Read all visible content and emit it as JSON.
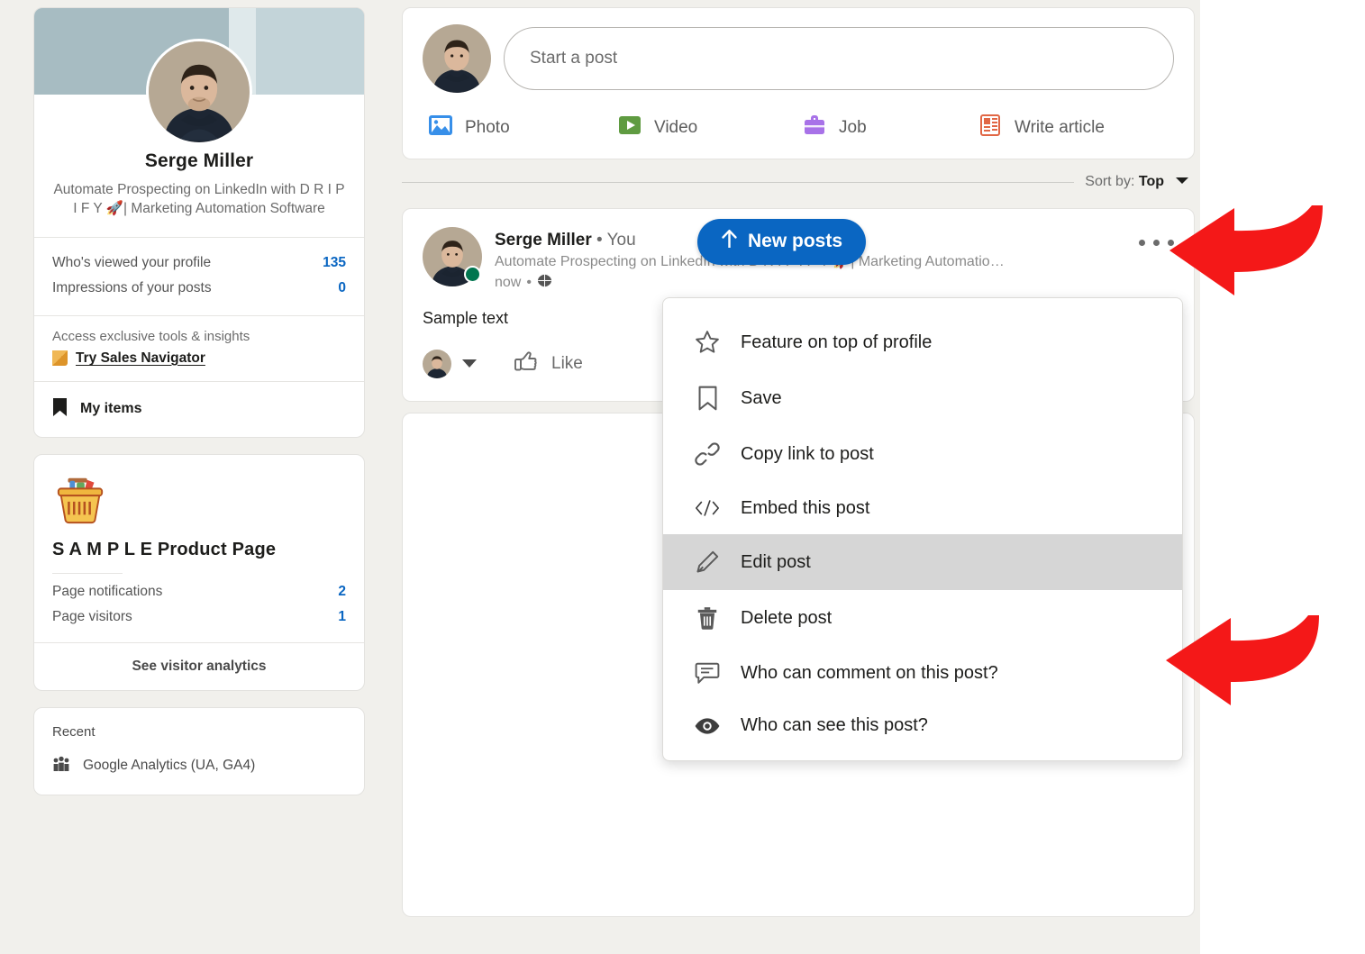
{
  "theme": {
    "accent": "#0a66c2",
    "page_bg": "#f1f0ec",
    "card_bg": "#ffffff",
    "arrow_color": "#f41818",
    "highlight_bg": "#d6d6d6",
    "online_dot": "#01754f"
  },
  "sidebar": {
    "profile": {
      "name": "Serge Miller",
      "headline": "Automate Prospecting on LinkedIn with D R I P I F Y 🚀| Marketing Automation Software",
      "avatar_alt": "serge-miller-avatar"
    },
    "stats": [
      {
        "label": "Who's viewed your profile",
        "value": "135"
      },
      {
        "label": "Impressions of your posts",
        "value": "0"
      }
    ],
    "promo": {
      "text": "Access exclusive tools & insights",
      "link": "Try Sales Navigator",
      "icon": "gold-square-icon"
    },
    "my_items": {
      "label": "My items",
      "icon": "bookmark-icon"
    },
    "product_page": {
      "icon": "shopping-basket-icon",
      "title": "S A M P L E Product Page",
      "stats": [
        {
          "label": "Page notifications",
          "value": "2"
        },
        {
          "label": "Page visitors",
          "value": "1"
        }
      ],
      "cta": "See visitor analytics"
    },
    "recent": {
      "title": "Recent",
      "items": [
        {
          "label": "Google Analytics (UA, GA4)",
          "icon": "group-icon"
        }
      ]
    }
  },
  "composer": {
    "placeholder": "Start a post",
    "avatar_alt": "composer-avatar",
    "actions": [
      {
        "label": "Photo",
        "icon": "photo-icon",
        "color": "#378fe9"
      },
      {
        "label": "Video",
        "icon": "video-icon",
        "color": "#5f9b41"
      },
      {
        "label": "Job",
        "icon": "job-icon",
        "color": "#a872e8"
      },
      {
        "label": "Write article",
        "icon": "article-icon",
        "color": "#e16745"
      }
    ]
  },
  "sort": {
    "prefix": "Sort by:",
    "value": "Top",
    "caret": "chevron-down-icon"
  },
  "new_posts_button": {
    "label": "New posts",
    "icon": "arrow-up-icon"
  },
  "post": {
    "author": "Serge Miller",
    "separator": "•",
    "relation": "You",
    "subtitle": "Automate Prospecting on LinkedIn with D R I P I F Y 🚀| Marketing Automatio…",
    "time": "now",
    "time_separator": "•",
    "visibility_icon": "globe-icon",
    "menu_icon": "ellipsis-icon",
    "body": "Sample text",
    "actions": {
      "reaction_picker": "reaction-avatar-with-caret",
      "like_label": "Like",
      "like_icon": "thumbs-up-icon"
    }
  },
  "menu": {
    "items": [
      {
        "label": "Feature on top of profile",
        "icon": "star-icon",
        "active": false
      },
      {
        "label": "Save",
        "icon": "bookmark-icon",
        "active": false
      },
      {
        "label": "Copy link to post",
        "icon": "link-icon",
        "active": false
      },
      {
        "label": "Embed this post",
        "icon": "code-icon",
        "active": false
      },
      {
        "label": "Edit post",
        "icon": "pencil-icon",
        "active": true
      },
      {
        "label": "Delete post",
        "icon": "trash-icon",
        "active": false
      },
      {
        "label": "Who can comment on this post?",
        "icon": "comment-icon",
        "active": false
      },
      {
        "label": "Who can see this post?",
        "icon": "eye-icon",
        "active": false
      }
    ]
  },
  "annotations": [
    {
      "name": "arrow-to-ellipsis-menu",
      "shape": "curved-left-arrow"
    },
    {
      "name": "arrow-to-edit-post",
      "shape": "curved-left-arrow"
    }
  ]
}
